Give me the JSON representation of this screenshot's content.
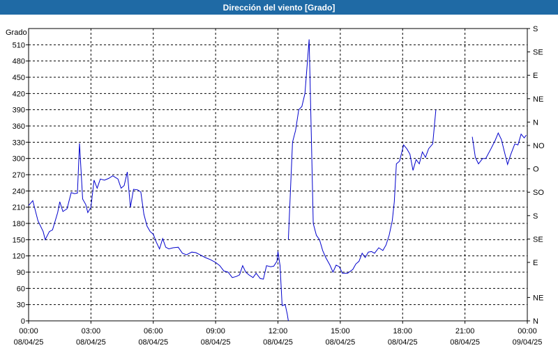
{
  "title": "Dirección del viento [Grado]",
  "colors": {
    "title_bg": "#1f6aa5",
    "title_fg": "#ffffff",
    "line": "#0000cc",
    "grid": "#000000"
  },
  "chart_data": {
    "type": "line",
    "title": "Dirección del viento [Grado]",
    "ylabel": "Grado",
    "xlabel": "",
    "ylim": [
      0,
      540
    ],
    "y_ticks": [
      0,
      30,
      60,
      90,
      120,
      150,
      180,
      210,
      240,
      270,
      300,
      330,
      360,
      390,
      420,
      450,
      480,
      510
    ],
    "y2_ticks": [
      {
        "value": 0,
        "label": "N"
      },
      {
        "value": 22.5,
        "label": "NE"
      },
      {
        "value": 56.25,
        "label": "E"
      },
      {
        "value": 78.75,
        "label": "SE"
      },
      {
        "value": 101.25,
        "label": "S"
      },
      {
        "value": 123.75,
        "label": "SO"
      },
      {
        "value": 146.25,
        "label": "O"
      },
      {
        "value": 168.75,
        "label": "NO"
      },
      {
        "value": 191.25,
        "label": "N"
      },
      {
        "value": 213.75,
        "label": "NE"
      },
      {
        "value": 236.25,
        "label": "E"
      },
      {
        "value": 258.75,
        "label": "SE"
      },
      {
        "value": 281.25,
        "label": "S"
      }
    ],
    "y2_scale": 1.92,
    "x_ticks": [
      {
        "hours": 0,
        "time": "00:00",
        "date": "08/04/25"
      },
      {
        "hours": 3,
        "time": "03:00",
        "date": "08/04/25"
      },
      {
        "hours": 6,
        "time": "06:00",
        "date": "08/04/25"
      },
      {
        "hours": 9,
        "time": "09:00",
        "date": "08/04/25"
      },
      {
        "hours": 12,
        "time": "12:00",
        "date": "08/04/25"
      },
      {
        "hours": 15,
        "time": "15:00",
        "date": "08/04/25"
      },
      {
        "hours": 18,
        "time": "18:00",
        "date": "08/04/25"
      },
      {
        "hours": 21,
        "time": "21:00",
        "date": "08/04/25"
      },
      {
        "hours": 24,
        "time": "00:00",
        "date": "09/04/25"
      }
    ],
    "xlim_hours": [
      0,
      24
    ],
    "grid": true,
    "series": [
      {
        "segments": [
          [
            [
              0,
              213
            ],
            [
              0.2,
              222
            ],
            [
              0.45,
              185
            ],
            [
              0.7,
              165
            ],
            [
              0.8,
              150
            ],
            [
              1.0,
              165
            ],
            [
              1.15,
              168
            ],
            [
              1.4,
              200
            ],
            [
              1.5,
              220
            ],
            [
              1.65,
              202
            ],
            [
              1.85,
              207
            ],
            [
              2.05,
              237
            ],
            [
              2.2,
              235
            ],
            [
              2.35,
              236
            ],
            [
              2.45,
              328
            ],
            [
              2.6,
              225
            ],
            [
              2.75,
              215
            ],
            [
              2.85,
              200
            ],
            [
              3.0,
              210
            ],
            [
              3.15,
              260
            ],
            [
              3.3,
              245
            ],
            [
              3.45,
              262
            ],
            [
              3.65,
              260
            ],
            [
              3.85,
              263
            ],
            [
              4.05,
              268
            ],
            [
              4.3,
              262
            ],
            [
              4.45,
              245
            ],
            [
              4.6,
              250
            ],
            [
              4.75,
              275
            ],
            [
              4.9,
              210
            ],
            [
              5.05,
              243
            ],
            [
              5.25,
              242
            ],
            [
              5.4,
              238
            ],
            [
              5.55,
              197
            ],
            [
              5.7,
              175
            ],
            [
              5.85,
              165
            ],
            [
              6.0,
              160
            ],
            [
              6.15,
              145
            ],
            [
              6.3,
              133
            ],
            [
              6.45,
              152
            ],
            [
              6.6,
              136
            ],
            [
              6.75,
              133
            ],
            [
              6.95,
              135
            ],
            [
              7.2,
              136
            ],
            [
              7.4,
              125
            ],
            [
              7.6,
              122
            ],
            [
              7.85,
              127
            ],
            [
              8.05,
              126
            ],
            [
              8.25,
              122
            ],
            [
              8.5,
              117
            ],
            [
              8.75,
              113
            ],
            [
              9.0,
              108
            ],
            [
              9.2,
              102
            ],
            [
              9.4,
              92
            ],
            [
              9.6,
              90
            ],
            [
              9.8,
              80
            ],
            [
              10.0,
              82
            ],
            [
              10.15,
              85
            ],
            [
              10.3,
              102
            ],
            [
              10.45,
              90
            ],
            [
              10.6,
              85
            ],
            [
              10.8,
              80
            ],
            [
              10.95,
              88
            ],
            [
              11.15,
              78
            ],
            [
              11.3,
              77
            ],
            [
              11.45,
              102
            ],
            [
              11.65,
              100
            ],
            [
              11.8,
              101
            ],
            [
              11.95,
              110
            ],
            [
              12.0,
              128
            ],
            [
              12.1,
              102
            ],
            [
              12.2,
              28
            ],
            [
              12.35,
              30
            ],
            [
              12.45,
              12
            ],
            [
              12.5,
              0
            ]
          ],
          [
            [
              12.5,
              150
            ],
            [
              12.6,
              240
            ],
            [
              12.7,
              330
            ],
            [
              12.85,
              352
            ],
            [
              13.0,
              390
            ],
            [
              13.15,
              396
            ],
            [
              13.3,
              420
            ],
            [
              13.4,
              470
            ],
            [
              13.5,
              520
            ],
            [
              13.6,
              350
            ],
            [
              13.7,
              180
            ],
            [
              13.85,
              158
            ],
            [
              14.0,
              150
            ],
            [
              14.15,
              130
            ],
            [
              14.3,
              117
            ],
            [
              14.5,
              103
            ],
            [
              14.65,
              90
            ],
            [
              14.8,
              103
            ],
            [
              14.95,
              100
            ],
            [
              15.1,
              88
            ],
            [
              15.35,
              88
            ],
            [
              15.6,
              95
            ],
            [
              15.75,
              105
            ],
            [
              15.9,
              110
            ],
            [
              16.05,
              125
            ],
            [
              16.2,
              117
            ],
            [
              16.35,
              127
            ],
            [
              16.5,
              128
            ],
            [
              16.65,
              125
            ],
            [
              16.85,
              135
            ],
            [
              17.05,
              130
            ],
            [
              17.2,
              140
            ],
            [
              17.35,
              158
            ],
            [
              17.5,
              185
            ],
            [
              17.6,
              220
            ],
            [
              17.7,
              290
            ],
            [
              17.85,
              295
            ],
            [
              18.05,
              325
            ],
            [
              18.2,
              318
            ],
            [
              18.35,
              308
            ],
            [
              18.5,
              278
            ],
            [
              18.65,
              298
            ],
            [
              18.8,
              290
            ],
            [
              18.95,
              312
            ],
            [
              19.1,
              302
            ],
            [
              19.25,
              318
            ],
            [
              19.45,
              327
            ],
            [
              19.6,
              390
            ]
          ],
          [
            [
              21.35,
              340
            ],
            [
              21.5,
              302
            ],
            [
              21.65,
              290
            ],
            [
              21.85,
              300
            ],
            [
              22.0,
              300
            ],
            [
              22.25,
              318
            ],
            [
              22.45,
              333
            ],
            [
              22.6,
              347
            ],
            [
              22.75,
              335
            ],
            [
              22.9,
              312
            ],
            [
              23.05,
              289
            ],
            [
              23.2,
              307
            ],
            [
              23.4,
              327
            ],
            [
              23.55,
              325
            ],
            [
              23.7,
              345
            ],
            [
              23.85,
              338
            ],
            [
              23.95,
              343
            ]
          ]
        ]
      }
    ]
  }
}
